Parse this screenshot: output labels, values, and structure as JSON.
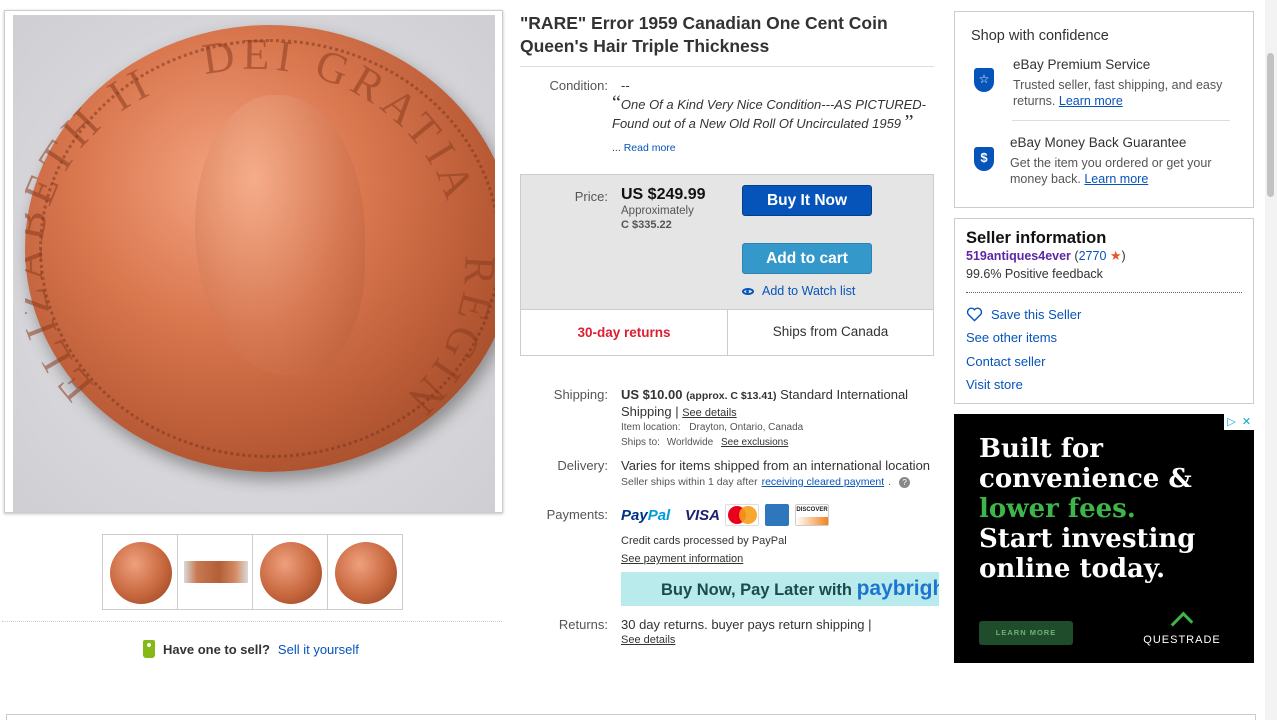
{
  "listing": {
    "title_line1": "\"RARE\" Error 1959 Canadian One Cent Coin",
    "title_line2": "Queen's Hair Triple Thickness",
    "condition_label": "Condition:",
    "condition_value": "--",
    "condition_quote_open": "“",
    "condition_quote_line1": "One Of a Kind Very Nice Condition---AS PICTURED-",
    "condition_quote_line2": "Found out of a New Old Roll Of Uncirculated 1959",
    "condition_quote_close": "”",
    "read_more_prefix": "...",
    "read_more": "Read more"
  },
  "buybox": {
    "price_label": "Price:",
    "price": "US $249.99",
    "approx_label": "Approximately",
    "approx_value": "C $335.22",
    "buy_now": "Buy It Now",
    "add_to_cart": "Add to cart",
    "watch": "Add to Watch list",
    "returns_badge": "30-day returns",
    "ships_from": "Ships from Canada"
  },
  "shipping": {
    "label": "Shipping:",
    "cost": "US $10.00",
    "approx": "(approx. C $13.41)",
    "method": "Standard International",
    "method2": "Shipping |",
    "see_details": "See details",
    "item_location_label": "Item location:",
    "item_location": "Drayton, Ontario, Canada",
    "ships_to_label": "Ships to:",
    "ships_to": "Worldwide",
    "see_exclusions": "See exclusions"
  },
  "delivery": {
    "label": "Delivery:",
    "text": "Varies for items shipped from an international location",
    "sub": "Seller ships within 1 day after",
    "sub_link": "receiving cleared payment",
    "sub_end": ".",
    "help": "?"
  },
  "payments": {
    "label": "Payments:",
    "paypal_1": "Pay",
    "paypal_2": "Pal",
    "visa": "VISA",
    "discover": "DISCOVER",
    "note": "Credit cards processed by PayPal",
    "see_info": "See payment information",
    "paybright_text": "Buy Now, Pay Later with ",
    "paybright_brand": "paybright"
  },
  "returns": {
    "label": "Returns:",
    "text": "30 day returns. buyer pays return shipping |",
    "see_details": "See details"
  },
  "sell": {
    "question": "Have one to sell?",
    "link": "Sell it yourself"
  },
  "confidence": {
    "title": "Shop with confidence",
    "premium_title": "eBay Premium Service",
    "premium_desc1": "Trusted seller, fast shipping, and easy",
    "premium_desc2": "returns.",
    "premium_link": "Learn more",
    "mbg_title": "eBay Money Back Guarantee",
    "mbg_desc1": "Get the item you ordered or get your",
    "mbg_desc2": "money back.",
    "mbg_link": "Learn more",
    "mbg_symbol": "$"
  },
  "seller": {
    "title": "Seller information",
    "name": "519antiques4ever",
    "score_open": "(",
    "score": "2770",
    "score_close": ")",
    "feedback": "99.6% Positive feedback",
    "save": "Save this Seller",
    "other_items": "See other items",
    "contact": "Contact seller",
    "store": "Visit store"
  },
  "ad": {
    "line1": "Built for",
    "line2": "convenience &",
    "line3": "lower fees.",
    "line4": "Start investing",
    "line5": "online today.",
    "cta": "LEARN MORE",
    "brand": "QUESTRADE",
    "adchoice": "▷",
    "close": "✕"
  },
  "coin": {
    "legend_left": "ELIZABETH II",
    "legend_top": "DEI GRATIA",
    "legend_right": "REGINA"
  },
  "colors": {
    "link": "#0654ba",
    "buy_button": "#0654ba",
    "cart_button": "#3498ca",
    "returns_red": "#dd1e31",
    "seller_purple": "#5d26a6",
    "ad_green": "#3db54a",
    "paybright_bg": "#b9ebec"
  }
}
